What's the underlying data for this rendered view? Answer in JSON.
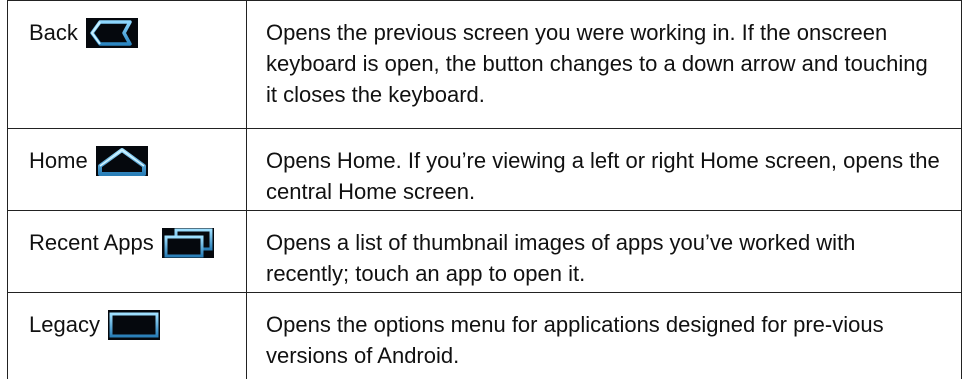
{
  "rows": [
    {
      "name": "Back",
      "icon": "back-icon",
      "description": "Opens the previous screen you were working in. If the onscreen keyboard is open, the button changes to a down arrow and touching it closes the keyboard."
    },
    {
      "name": "Home",
      "icon": "home-icon",
      "description": "Opens Home. If you’re viewing a left or right Home screen, opens the central Home screen."
    },
    {
      "name": "Recent Apps",
      "icon": "recent-apps-icon",
      "description": "Opens a list of thumbnail images of apps you’ve worked with recently; touch an app to open it."
    },
    {
      "name": "Legacy",
      "icon": "menu-grid-icon",
      "description": "Opens the options menu for applications designed for pre-vious versions of Android."
    }
  ],
  "colors": {
    "icon_background": "#05080d",
    "icon_glow": "#4fb6ec",
    "icon_glow_dark": "#1a5d86",
    "border": "#222222"
  }
}
